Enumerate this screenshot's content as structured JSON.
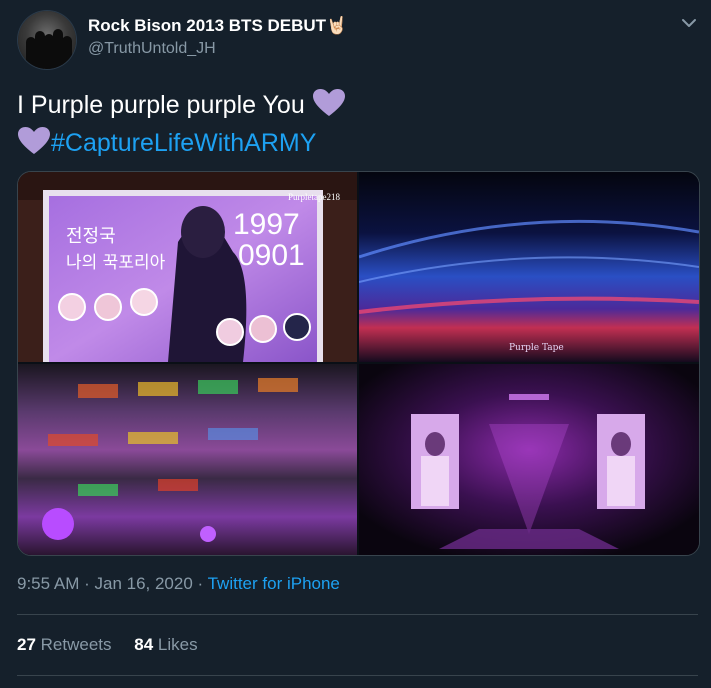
{
  "author": {
    "display_name": "Rock Bison 2013 BTS DEBUT",
    "name_emoji": "🤘🏻",
    "handle": "@TruthUntold_JH"
  },
  "tweet": {
    "text_line1": "I Purple purple purple You",
    "hashtag": "#CaptureLifeWithARMY",
    "heart_emoji": "💜"
  },
  "media": {
    "images": [
      {
        "description": "birthday billboard",
        "watermark": "Purpletape218",
        "korean_line1": "전정국",
        "korean_line2": "나의 꾹포리아",
        "date_top": "1997",
        "date_bottom": "0901"
      },
      {
        "description": "stadium blue lightsticks",
        "watermark": "Purple Tape"
      },
      {
        "description": "stadium rainbow lightsticks"
      },
      {
        "description": "stage purple lighting"
      }
    ]
  },
  "footer": {
    "time": "9:55 AM",
    "separator": " · ",
    "date": "Jan 16, 2020",
    "source": "Twitter for iPhone"
  },
  "stats": {
    "retweets_count": "27",
    "retweets_label": "Retweets",
    "likes_count": "84",
    "likes_label": "Likes"
  },
  "colors": {
    "background": "#15202b",
    "secondary_text": "#8899a6",
    "link": "#1da1f2",
    "divider": "#38444d",
    "heart": "#b19cd9"
  },
  "icons": {
    "caret": "chevron-down-icon",
    "heart": "purple-heart-icon"
  }
}
